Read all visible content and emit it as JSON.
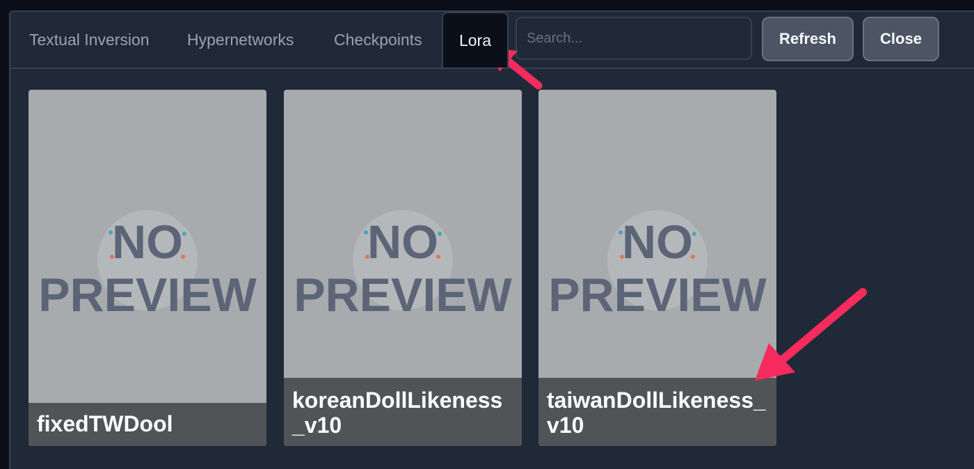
{
  "tabs": [
    {
      "label": "Textual Inversion"
    },
    {
      "label": "Hypernetworks"
    },
    {
      "label": "Checkpoints"
    },
    {
      "label": "Lora"
    }
  ],
  "search": {
    "placeholder": "Search..."
  },
  "buttons": {
    "refresh": "Refresh",
    "close": "Close"
  },
  "cards": [
    {
      "name": "fixedTWDool"
    },
    {
      "name": "koreanDollLikeness_v10"
    },
    {
      "name": "taiwanDollLikeness_v10"
    }
  ],
  "preview": {
    "line1": "NO",
    "line2": "PREVIEW"
  },
  "colors": {
    "background": "#0b0f19",
    "panel": "#1f2937",
    "card": "#a7abae",
    "preview_text": "#5c6577",
    "annotation_arrow": "#f72b5d"
  }
}
